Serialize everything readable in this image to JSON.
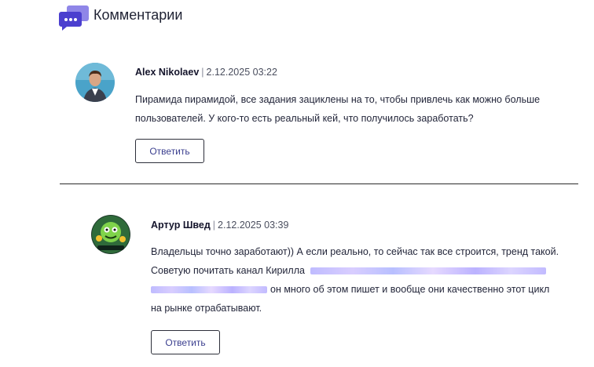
{
  "section": {
    "title": "Комментарии",
    "icon": "chat-bubbles-icon"
  },
  "comments": [
    {
      "author": "Alex Nikolaev",
      "separator": "|",
      "date": "2.12.2025 03:22",
      "lines": [
        "Пирамида пирамидой, все задания зациклены на то, чтобы привлечь как можно больше",
        "пользователей. У кого-то есть реальный кей, что получилось заработать?"
      ],
      "reply_label": "Ответить"
    },
    {
      "author": "Артур Швед",
      "separator": "|",
      "date": "2.12.2025 03:39",
      "lines": [
        "Владельцы точно заработают)) А если реально, то сейчас так все строится, тренд такой.",
        "Советую почитать канал Кирилла",
        "он много об этом пишет и вообще они качественно этот цикл",
        "на рынке отрабатывают."
      ],
      "reply_label": "Ответить"
    }
  ],
  "colors": {
    "accent": "#5b4fd6",
    "link_text": "#3b3f8f",
    "divider": "#2a2a2a"
  }
}
